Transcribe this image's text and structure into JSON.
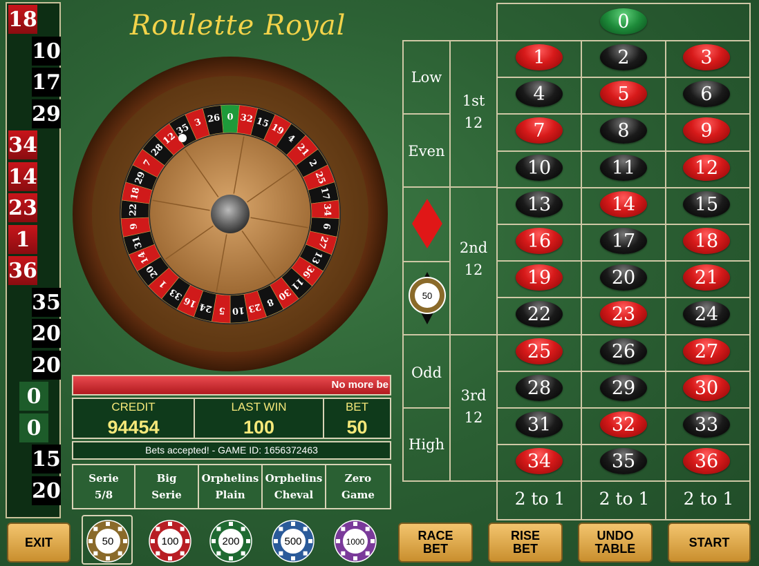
{
  "title": "Roulette Royal",
  "history": [
    {
      "n": "18",
      "c": "red"
    },
    {
      "n": "10",
      "c": "black"
    },
    {
      "n": "17",
      "c": "black"
    },
    {
      "n": "29",
      "c": "black"
    },
    {
      "n": "34",
      "c": "red"
    },
    {
      "n": "14",
      "c": "red"
    },
    {
      "n": "23",
      "c": "red"
    },
    {
      "n": "1",
      "c": "red"
    },
    {
      "n": "36",
      "c": "red"
    },
    {
      "n": "35",
      "c": "black"
    },
    {
      "n": "20",
      "c": "black"
    },
    {
      "n": "20",
      "c": "black"
    },
    {
      "n": "0",
      "c": "green"
    },
    {
      "n": "0",
      "c": "green"
    },
    {
      "n": "15",
      "c": "black"
    },
    {
      "n": "20",
      "c": "black"
    }
  ],
  "wheel": {
    "sequence": [
      "0",
      "32",
      "15",
      "19",
      "4",
      "21",
      "2",
      "25",
      "17",
      "34",
      "6",
      "27",
      "13",
      "36",
      "11",
      "30",
      "8",
      "23",
      "10",
      "5",
      "24",
      "16",
      "33",
      "1",
      "20",
      "14",
      "31",
      "9",
      "22",
      "18",
      "29",
      "7",
      "28",
      "12",
      "35",
      "3",
      "26"
    ],
    "reds": [
      "1",
      "3",
      "5",
      "7",
      "9",
      "12",
      "14",
      "16",
      "18",
      "19",
      "21",
      "23",
      "25",
      "27",
      "30",
      "32",
      "34",
      "36"
    ]
  },
  "message": "No more be",
  "stats": {
    "credit_label": "CREDIT",
    "credit_value": "94454",
    "lastwin_label": "LAST WIN",
    "lastwin_value": "100",
    "bet_label": "BET",
    "bet_value": "50"
  },
  "status": "Bets accepted! - GAME ID: 1656372463",
  "race_bets": [
    "Serie\n5/8",
    "Big\nSerie",
    "Orphelins\nPlain",
    "Orphelins\nCheval",
    "Zero\nGame"
  ],
  "table": {
    "zero": "0",
    "outside": {
      "low": "Low",
      "even": "Even",
      "odd": "Odd",
      "high": "High",
      "dozen1": "1st\n12",
      "dozen2": "2nd\n12",
      "dozen3": "3rd\n12"
    },
    "rows": [
      [
        "1",
        "2",
        "3"
      ],
      [
        "4",
        "5",
        "6"
      ],
      [
        "7",
        "8",
        "9"
      ],
      [
        "10",
        "11",
        "12"
      ],
      [
        "13",
        "14",
        "15"
      ],
      [
        "16",
        "17",
        "18"
      ],
      [
        "19",
        "20",
        "21"
      ],
      [
        "22",
        "23",
        "24"
      ],
      [
        "25",
        "26",
        "27"
      ],
      [
        "28",
        "29",
        "30"
      ],
      [
        "31",
        "32",
        "33"
      ],
      [
        "34",
        "35",
        "36"
      ]
    ],
    "column_label": "2 to 1"
  },
  "bet_chip_value": "50",
  "chips": [
    {
      "value": "50",
      "color": "#8a6a2a"
    },
    {
      "value": "100",
      "color": "#b81e24"
    },
    {
      "value": "200",
      "color": "#1f6a32"
    },
    {
      "value": "500",
      "color": "#2b5b9a"
    },
    {
      "value": "1000",
      "color": "#7a3a9a"
    }
  ],
  "buttons": {
    "exit": "EXIT",
    "race_bet": "RACE\nBET",
    "rise_bet": "RISE\nBET",
    "undo_table": "UNDO\nTABLE",
    "start": "START"
  }
}
